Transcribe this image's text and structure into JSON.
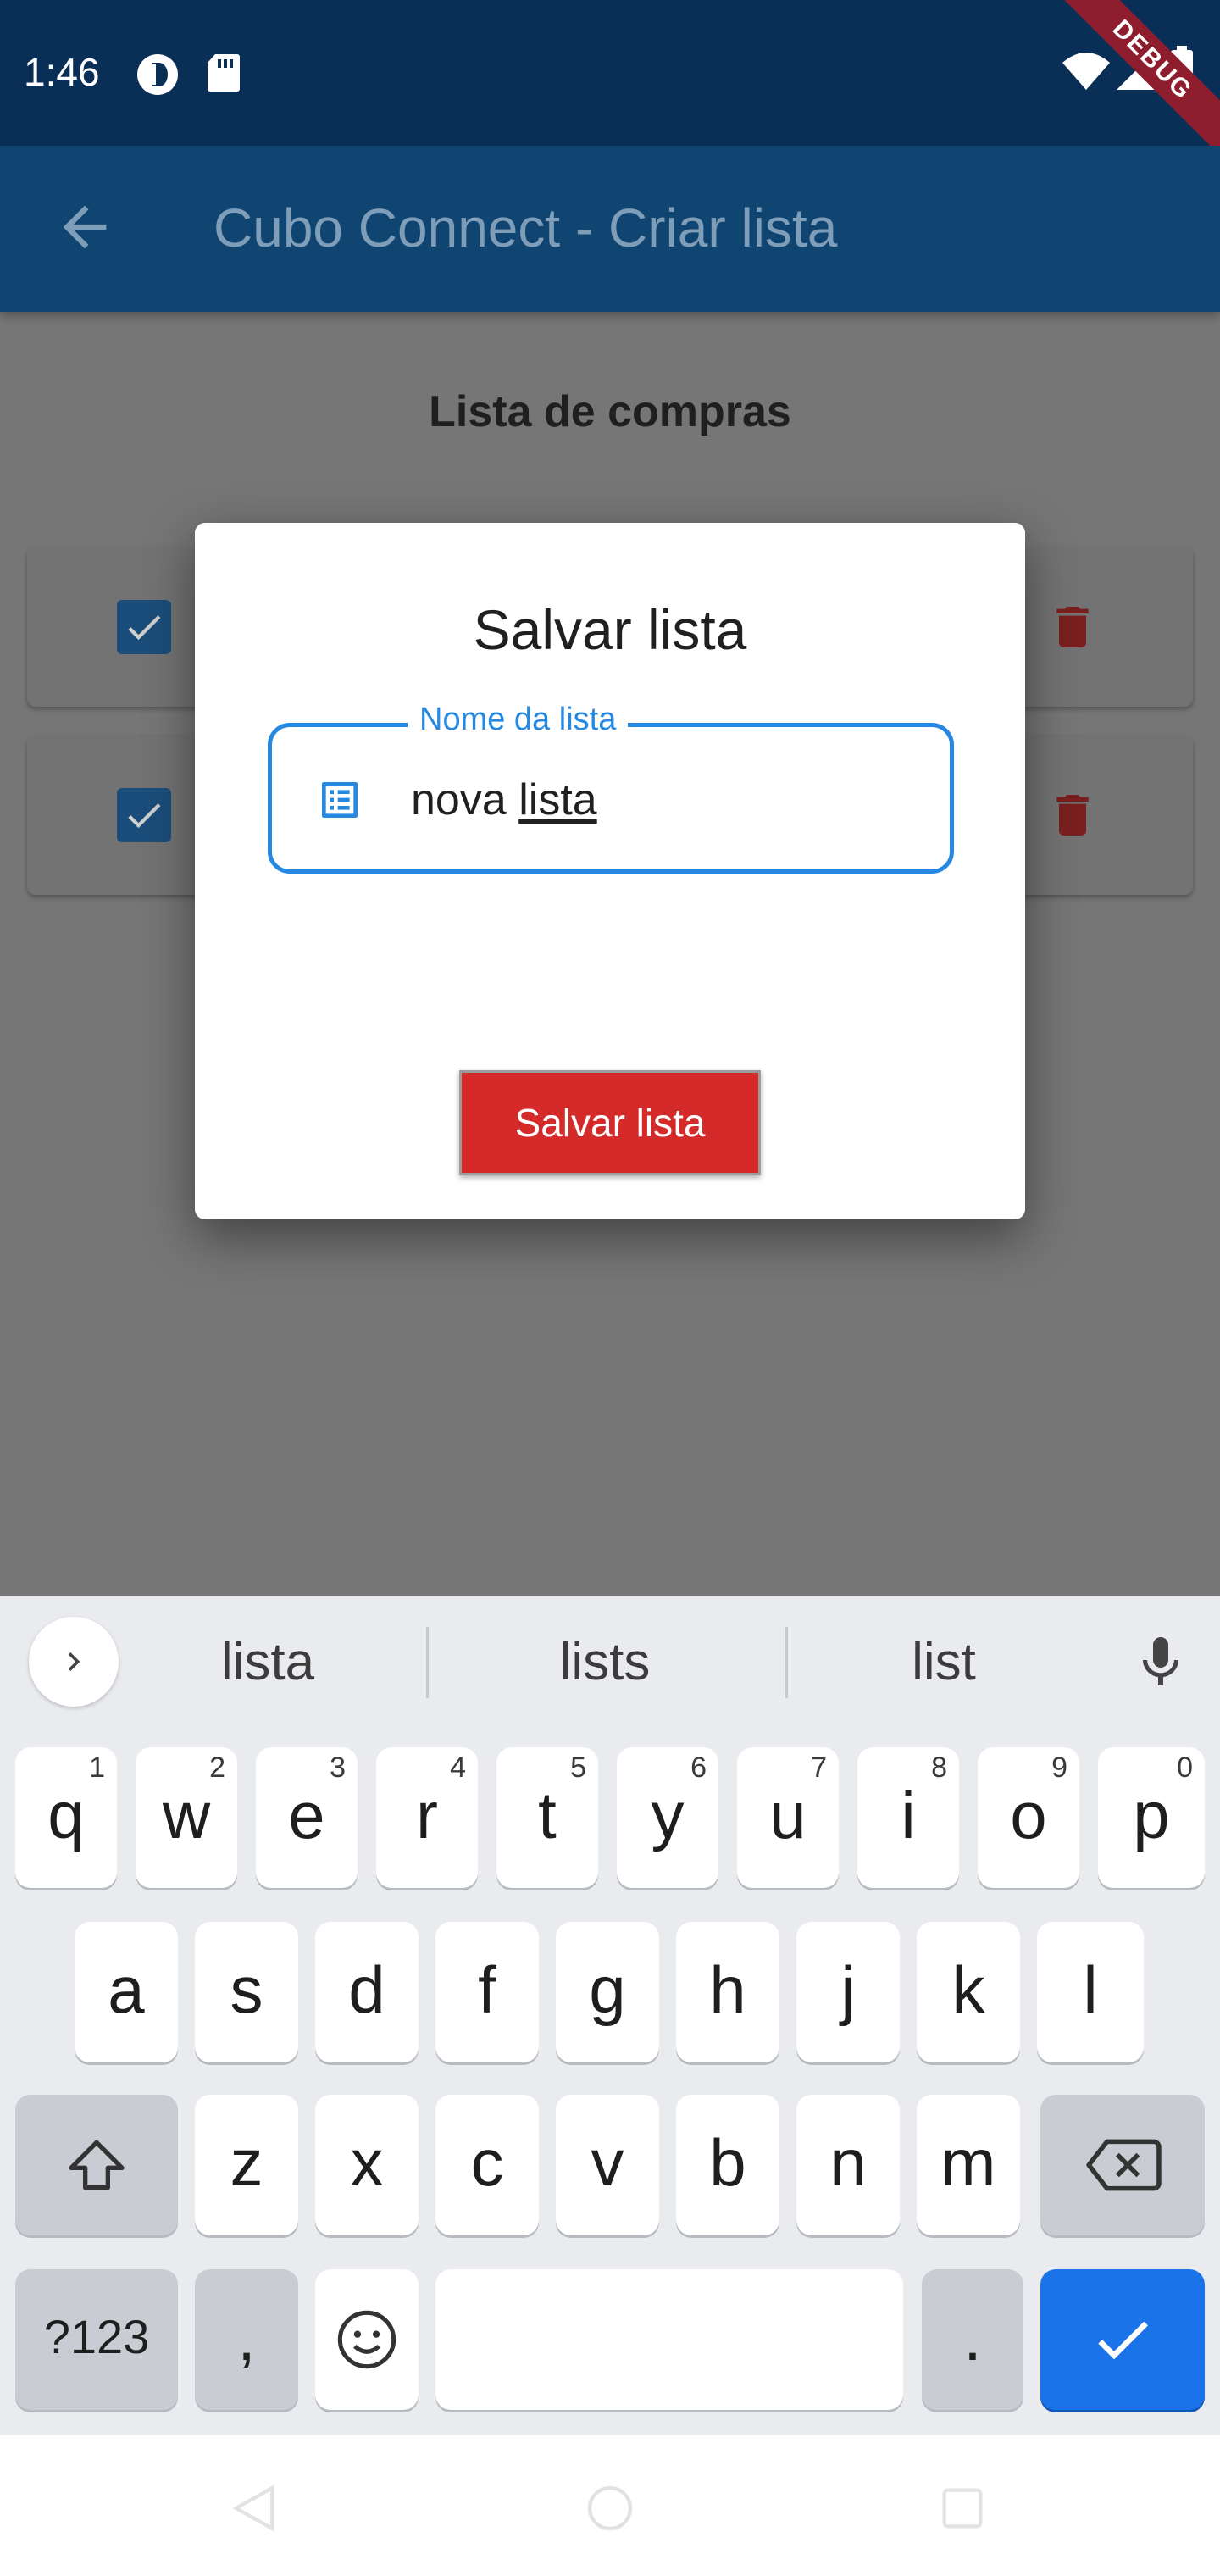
{
  "status_bar": {
    "time": "1:46",
    "icons": [
      "accessibility-icon",
      "sd-card-icon",
      "wifi-icon",
      "signal-icon",
      "battery-icon"
    ],
    "debug_label": "DEBUG"
  },
  "app_bar": {
    "title": "Cubo Connect - Criar lista",
    "back_icon": "arrow-back-icon"
  },
  "page": {
    "heading": "Lista de compras",
    "items": [
      {
        "checked": true
      },
      {
        "checked": true
      }
    ]
  },
  "dialog": {
    "title": "Salvar lista",
    "field_label": "Nome da lista",
    "field_value_plain": "nova ",
    "field_value_composing": "lista",
    "field_value": "nova lista",
    "save_label": "Salvar lista"
  },
  "keyboard": {
    "suggestions": [
      "lista",
      "lists",
      "list"
    ],
    "row1": [
      "q",
      "w",
      "e",
      "r",
      "t",
      "y",
      "u",
      "i",
      "o",
      "p"
    ],
    "row1_hints": [
      "1",
      "2",
      "3",
      "4",
      "5",
      "6",
      "7",
      "8",
      "9",
      "0"
    ],
    "row2": [
      "a",
      "s",
      "d",
      "f",
      "g",
      "h",
      "j",
      "k",
      "l"
    ],
    "row3": [
      "z",
      "x",
      "c",
      "v",
      "b",
      "n",
      "m"
    ],
    "symbols_label": "?123",
    "comma_label": ",",
    "period_label": "."
  },
  "colors": {
    "status_bar": "#0a2f57",
    "app_bar": "#114571",
    "accent": "#2688e0",
    "danger": "#d42a2a",
    "enter_key": "#1a73e8"
  }
}
